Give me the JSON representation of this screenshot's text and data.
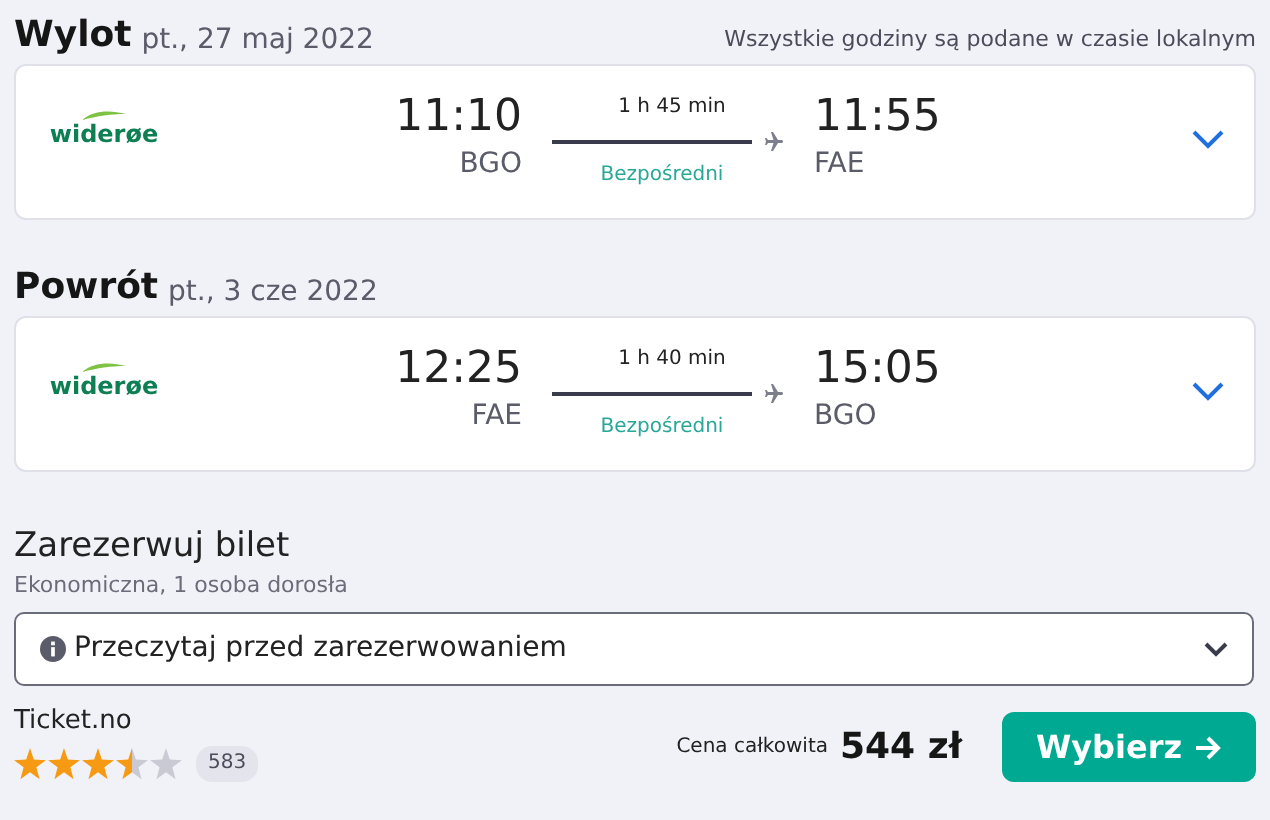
{
  "legs": [
    {
      "title": "Wylot",
      "date": "pt., 27 maj 2022",
      "note": "Wszystkie godziny są podane w czasie lokalnym",
      "airline": "widerøe",
      "dep_time": "11:10",
      "dep_code": "BGO",
      "duration": "1 h 45 min",
      "stops": "Bezpośredni",
      "arr_time": "11:55",
      "arr_code": "FAE",
      "expanded": false
    },
    {
      "title": "Powrót",
      "date": "pt., 3 cze 2022",
      "airline": "widerøe",
      "dep_time": "12:25",
      "dep_code": "FAE",
      "duration": "1 h 40 min",
      "stops": "Bezpośredni",
      "arr_time": "15:05",
      "arr_code": "BGO",
      "expanded": false
    }
  ],
  "booking": {
    "title": "Zarezerwuj bilet",
    "subtitle": "Ekonomiczna, 1 osoba dorosła",
    "notice": "Przeczytaj przed zarezerwowaniem",
    "provider": "Ticket.no",
    "stars": 3.5,
    "reviews": "583",
    "price_label": "Cena całkowita",
    "price": "544 zł",
    "button": "Wybierz"
  }
}
